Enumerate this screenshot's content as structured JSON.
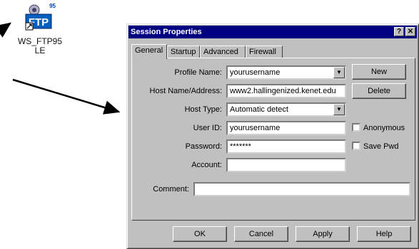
{
  "desktop_icon": {
    "badge": "95",
    "name": "WS_FTP95",
    "edition": "LE"
  },
  "dialog": {
    "title": "Session Properties",
    "help_glyph": "?",
    "close_glyph": "✕",
    "tabs": [
      "General",
      "Startup",
      "Advanced",
      "Firewall"
    ],
    "fields": {
      "profile_name": {
        "label": "Profile Name:",
        "value": "yourusername"
      },
      "host_name": {
        "label": "Host Name/Address:",
        "value": "www2.hallingenized.kenet.edu"
      },
      "host_type": {
        "label": "Host Type:",
        "value": "Automatic detect"
      },
      "user_id": {
        "label": "User ID:",
        "value": "yourusername"
      },
      "password": {
        "label": "Password:",
        "value": "*******"
      },
      "account": {
        "label": "Account:",
        "value": ""
      },
      "comment": {
        "label": "Comment:",
        "value": ""
      }
    },
    "side_buttons": {
      "new": "New",
      "delete": "Delete"
    },
    "checkboxes": {
      "anonymous": "Anonymous",
      "save_pwd": "Save Pwd"
    },
    "footer_buttons": {
      "ok": "OK",
      "cancel": "Cancel",
      "apply": "Apply",
      "help": "Help"
    }
  }
}
